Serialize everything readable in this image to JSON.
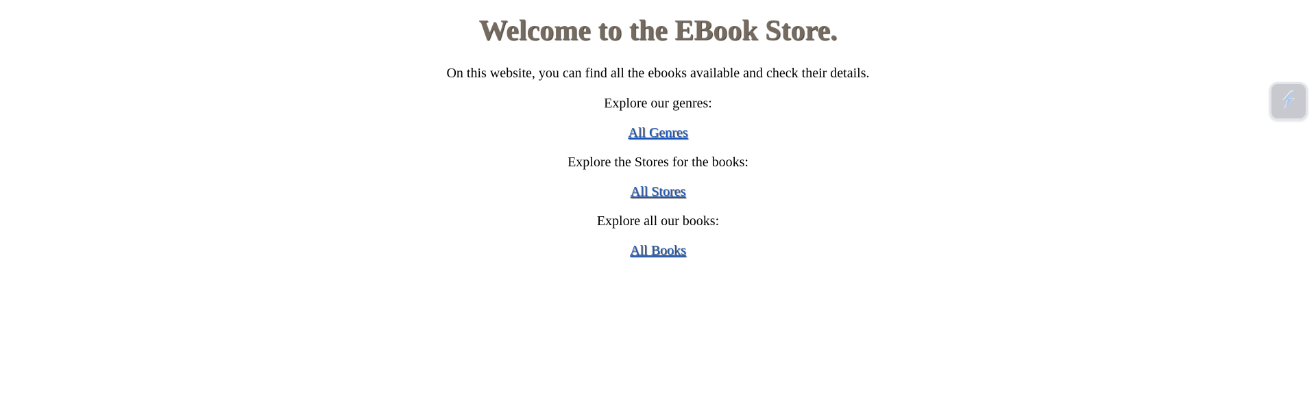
{
  "header": {
    "title": "Welcome to the EBook Store."
  },
  "intro": "On this website, you can find all the ebooks available and check their details.",
  "sections": [
    {
      "prompt": "Explore our genres:",
      "link_label": "All Genres"
    },
    {
      "prompt": "Explore the Stores for the books:",
      "link_label": "All Stores"
    },
    {
      "prompt": "Explore all our books:",
      "link_label": "All Books"
    }
  ],
  "colors": {
    "title": "#756b60",
    "link": "#1a56b8",
    "extension_button": "#c7c9cf"
  },
  "extension": {
    "icon": "lightning-icon"
  }
}
